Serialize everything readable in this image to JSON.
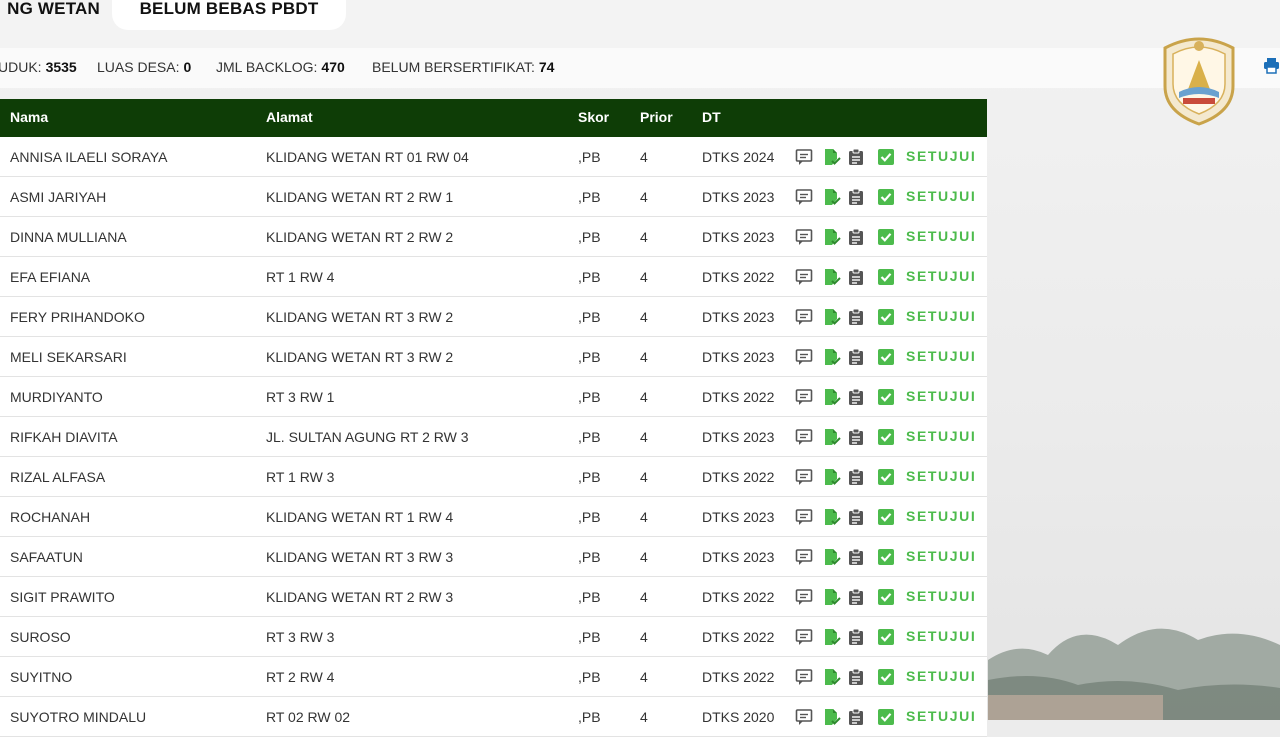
{
  "tabs": [
    {
      "label": "NG WETAN"
    },
    {
      "label": "BELUM BEBAS PBDT"
    }
  ],
  "stats": [
    {
      "label": "UDUK:",
      "value": "3535"
    },
    {
      "label": "LUAS DESA:",
      "value": "0"
    },
    {
      "label": "JML BACKLOG:",
      "value": "470"
    },
    {
      "label": "BELUM BERSERTIFIKAT:",
      "value": "74"
    }
  ],
  "table": {
    "headers": {
      "nama": "Nama",
      "alamat": "Alamat",
      "skor": "Skor",
      "prior": "Prior",
      "dt": "DT"
    },
    "approve_label": "SETUJUI",
    "rows": [
      {
        "nama": "ANNISA ILAELI SORAYA",
        "alamat": "KLIDANG WETAN RT 01 RW 04",
        "skor": ",PB",
        "prior": "4",
        "dt": "DTKS 2024"
      },
      {
        "nama": "ASMI JARIYAH",
        "alamat": "KLIDANG WETAN RT 2 RW 1",
        "skor": ",PB",
        "prior": "4",
        "dt": "DTKS 2023"
      },
      {
        "nama": "DINNA MULLIANA",
        "alamat": "KLIDANG WETAN RT 2 RW 2",
        "skor": ",PB",
        "prior": "4",
        "dt": "DTKS 2023"
      },
      {
        "nama": "EFA EFIANA",
        "alamat": "RT 1 RW 4",
        "skor": ",PB",
        "prior": "4",
        "dt": "DTKS 2022"
      },
      {
        "nama": "FERY PRIHANDOKO",
        "alamat": "KLIDANG WETAN RT 3 RW 2",
        "skor": ",PB",
        "prior": "4",
        "dt": "DTKS 2023"
      },
      {
        "nama": "MELI SEKARSARI",
        "alamat": "KLIDANG WETAN RT 3 RW 2",
        "skor": ",PB",
        "prior": "4",
        "dt": "DTKS 2023"
      },
      {
        "nama": "MURDIYANTO",
        "alamat": "RT 3 RW 1",
        "skor": ",PB",
        "prior": "4",
        "dt": "DTKS 2022"
      },
      {
        "nama": "RIFKAH DIAVITA",
        "alamat": "JL. SULTAN AGUNG RT 2 RW 3",
        "skor": ",PB",
        "prior": "4",
        "dt": "DTKS 2023"
      },
      {
        "nama": "RIZAL ALFASA",
        "alamat": "RT 1 RW 3",
        "skor": ",PB",
        "prior": "4",
        "dt": "DTKS 2022"
      },
      {
        "nama": "ROCHANAH",
        "alamat": "KLIDANG WETAN RT 1 RW 4",
        "skor": ",PB",
        "prior": "4",
        "dt": "DTKS 2023"
      },
      {
        "nama": "SAFAATUN",
        "alamat": "KLIDANG WETAN RT 3 RW 3",
        "skor": ",PB",
        "prior": "4",
        "dt": "DTKS 2023"
      },
      {
        "nama": "SIGIT PRAWITO",
        "alamat": "KLIDANG WETAN RT 2 RW 3",
        "skor": ",PB",
        "prior": "4",
        "dt": "DTKS 2022"
      },
      {
        "nama": "SUROSO",
        "alamat": "RT 3 RW 3",
        "skor": ",PB",
        "prior": "4",
        "dt": "DTKS 2022"
      },
      {
        "nama": "SUYITNO",
        "alamat": "RT 2 RW 4",
        "skor": ",PB",
        "prior": "4",
        "dt": "DTKS 2022"
      },
      {
        "nama": "SUYOTRO MINDALU",
        "alamat": "RT 02 RW 02",
        "skor": ",PB",
        "prior": "4",
        "dt": "DTKS 2020"
      }
    ]
  },
  "icons": {
    "comment": "comment-icon",
    "document": "document-check-icon",
    "clipboard": "clipboard-icon",
    "checkbox": "checkbox-checked-icon",
    "print": "print-icon",
    "logo": "province-emblem-logo"
  },
  "colors": {
    "header_bg": "#0e3d06",
    "accent_green": "#4cbb4c",
    "icon_gray": "#555555"
  }
}
